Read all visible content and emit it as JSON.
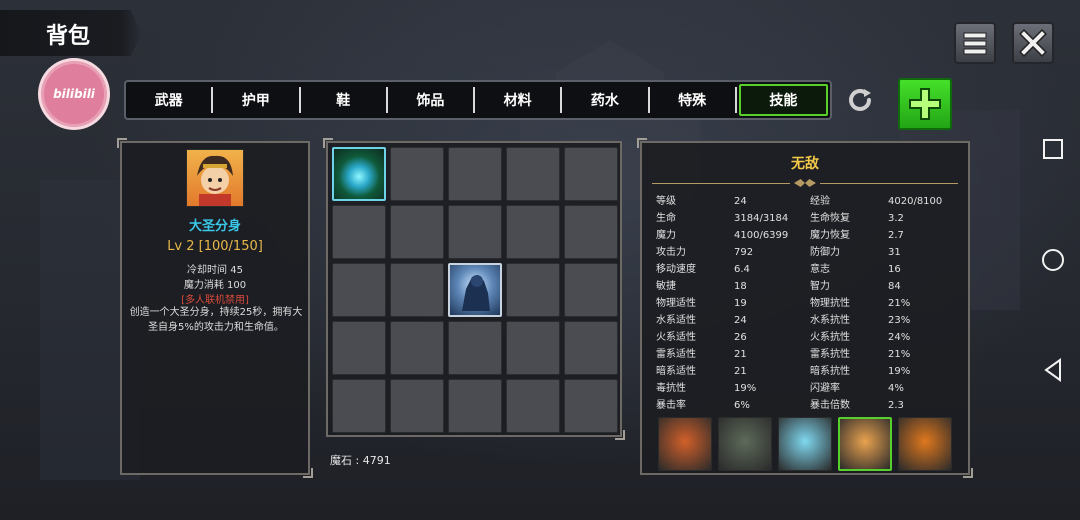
{
  "header": {
    "title": "背包",
    "logo_text": "bilibili"
  },
  "tabs": [
    {
      "label": "武器",
      "active": false
    },
    {
      "label": "护甲",
      "active": false
    },
    {
      "label": "鞋",
      "active": false
    },
    {
      "label": "饰品",
      "active": false
    },
    {
      "label": "材料",
      "active": false
    },
    {
      "label": "药水",
      "active": false
    },
    {
      "label": "特殊",
      "active": false
    },
    {
      "label": "技能",
      "active": true
    }
  ],
  "buttons": {
    "refresh_icon": "refresh-icon",
    "add_icon": "plus-icon",
    "menu_icon": "menu-icon",
    "close_icon": "close-icon"
  },
  "skill": {
    "name": "大圣分身",
    "level": "Lv 2 [100/150]",
    "cooldown": "冷却时间 45",
    "mana_cost": "魔力消耗 100",
    "warning": "[多人联机禁用]",
    "description": "创造一个大圣分身，持续25秒，拥有大圣自身5%的攻击力和生命值。"
  },
  "inventory": {
    "currency_label": "魔石 : 4791",
    "cells": [
      "orb",
      "",
      "",
      "",
      "",
      "",
      "",
      "",
      "",
      "",
      "",
      "",
      "shadow",
      "",
      "",
      "",
      "",
      "",
      "",
      "",
      "",
      "",
      "",
      "",
      ""
    ]
  },
  "stats": {
    "title": "无敌",
    "rows": [
      [
        "等级",
        "24",
        "经验",
        "4020/8100"
      ],
      [
        "生命",
        "3184/3184",
        "生命恢复",
        "3.2"
      ],
      [
        "魔力",
        "4100/6399",
        "魔力恢复",
        "2.7"
      ],
      [
        "攻击力",
        "792",
        "防御力",
        "31"
      ],
      [
        "移动速度",
        "6.4",
        "意志",
        "16"
      ],
      [
        "敏捷",
        "18",
        "智力",
        "84"
      ],
      [
        "物理适性",
        "19",
        "物理抗性",
        "21%"
      ],
      [
        "水系适性",
        "24",
        "水系抗性",
        "23%"
      ],
      [
        "火系适性",
        "26",
        "火系抗性",
        "24%"
      ],
      [
        "雷系适性",
        "21",
        "雷系抗性",
        "21%"
      ],
      [
        "暗系适性",
        "21",
        "暗系抗性",
        "19%"
      ],
      [
        "毒抗性",
        "19%",
        "闪避率",
        "4%"
      ],
      [
        "暴击率",
        "6%",
        "暴击倍数",
        "2.3"
      ]
    ]
  },
  "heroes": [
    {
      "name": "lava-golem",
      "selected": false,
      "color": "#d2602a"
    },
    {
      "name": "stone-golem",
      "selected": false,
      "color": "#5d6a5a"
    },
    {
      "name": "ice-golem",
      "selected": false,
      "color": "#7fd8f0"
    },
    {
      "name": "monkey-king",
      "selected": true,
      "color": "#e9a24f"
    },
    {
      "name": "fire-fist",
      "selected": false,
      "color": "#e0781e"
    }
  ],
  "colors": {
    "active_tab_border": "#57d02e",
    "skill_name": "#39c8e8",
    "skill_level": "#e7b94a",
    "warning": "#d94a3a",
    "stats_title": "#f3c948"
  }
}
